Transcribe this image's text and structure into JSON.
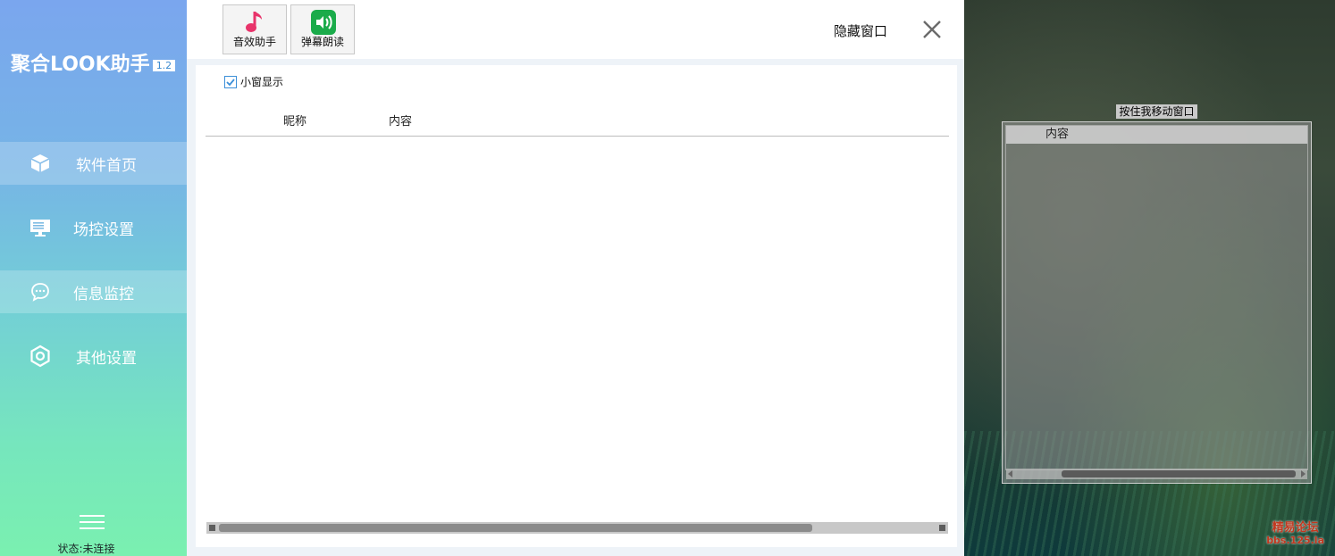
{
  "sidebar": {
    "brand": "聚合LOOK助手",
    "version": "1.2",
    "items": [
      {
        "label": "软件首页",
        "icon": "cube-icon",
        "active": true
      },
      {
        "label": "场控设置",
        "icon": "monitor-icon",
        "active": false
      },
      {
        "label": "信息监控",
        "icon": "chat-bubble-icon",
        "active": true
      },
      {
        "label": "其他设置",
        "icon": "settings-hex-icon",
        "active": false
      }
    ],
    "menu_icon": "hamburger-icon",
    "status": "状态:未连接"
  },
  "toolbar": {
    "buttons": [
      {
        "label": "音效助手",
        "icon": "music-note-icon",
        "color": "#e8336a"
      },
      {
        "label": "弹幕朗读",
        "icon": "speaker-icon",
        "color": "#1aab4a"
      }
    ],
    "hide_window": "隐藏窗口",
    "close_icon": "close-icon"
  },
  "content": {
    "checkbox": {
      "label": "小窗显示",
      "checked": true
    },
    "columns": [
      "昵称",
      "内容"
    ]
  },
  "mini_window": {
    "title": "按住我移动窗口",
    "column": "内容"
  },
  "watermark": {
    "line1": "精易论坛",
    "line2": "bbs.125.la"
  },
  "colors": {
    "accent": "#3c8fd8",
    "sidebar_top": "#7aa6ee",
    "sidebar_bottom": "#7af0b0"
  }
}
